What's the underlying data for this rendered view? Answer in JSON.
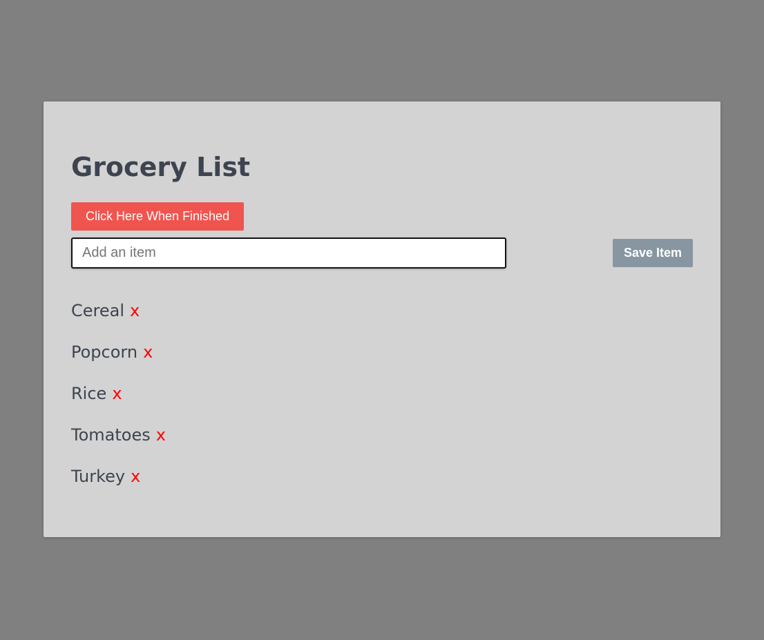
{
  "app": {
    "title": "Grocery List"
  },
  "actions": {
    "finish_label": "Click Here When Finished",
    "save_label": "Save Item"
  },
  "input": {
    "value": "",
    "placeholder": "Add an item"
  },
  "items": [
    {
      "name": "Cereal",
      "remove": "x"
    },
    {
      "name": "Popcorn",
      "remove": "x"
    },
    {
      "name": "Rice",
      "remove": "x"
    },
    {
      "name": "Tomatoes",
      "remove": "x"
    },
    {
      "name": "Turkey",
      "remove": "x"
    }
  ],
  "colors": {
    "page_background": "#808080",
    "card_background": "#d3d3d3",
    "finish_button": "#f0544f",
    "save_button": "#8796a1",
    "text": "#3d4450",
    "remove_x": "#ff0000"
  }
}
